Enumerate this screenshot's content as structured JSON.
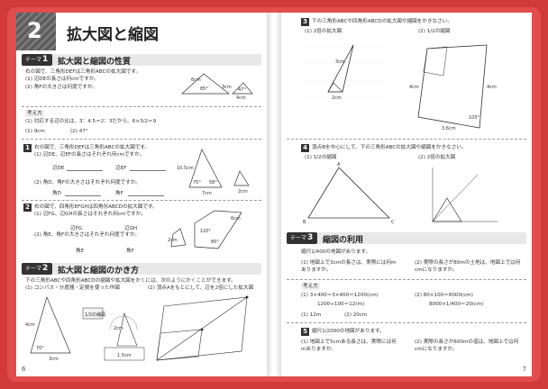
{
  "left": {
    "chapter_number": "2",
    "chapter_title": "拡大図と縮図",
    "page_number": "6",
    "theme1": {
      "tag": "テーマ",
      "num": "1",
      "title": "拡大図と縮図の性質",
      "lines": [
        "右の図で、三角形DEFは三角形ABCの拡大図です。",
        "(1) 辺DEの長さは何cmですか。",
        "(2) 角Fの大きさは何度ですか。"
      ],
      "answer_label": "考え方",
      "answer_line": "(1) 対応する辺の比は、3：4.5＝2：3だから、6×3/2＝9",
      "answers": [
        "(1) 9cm",
        "(2) 47°"
      ],
      "fig_labels": [
        "6cm",
        "85°",
        "3cm",
        "47°",
        "4cm"
      ]
    },
    "q1": {
      "num": "1",
      "lines": [
        "右の図で、三角形DEFは三角形ABCの拡大図です。",
        "(1) 辺DE、辺EFの長さはそれぞれ何cmですか。",
        "(2) 角D、角Fの大きさはそれぞれ何度ですか。"
      ],
      "blanks": [
        "辺DE",
        "辺EF",
        "角D",
        "角F"
      ],
      "fig_labels": [
        "10.5cm",
        "75°",
        "58°",
        "7cm",
        "2cm"
      ]
    },
    "q2": {
      "num": "2",
      "lines": [
        "右の図で、四角形EFGHは四角形ABCDの拡大図です。",
        "(1) 辺FG、辺GHの長さはそれぞれ何cmですか。",
        "(2) 角E、角Fの大きさはそれぞれ何度ですか。"
      ],
      "blanks": [
        "辺FG",
        "辺GH",
        "角E",
        "角F"
      ],
      "fig_labels": [
        "6cm",
        "2cm",
        "120°",
        "80°"
      ]
    },
    "theme2": {
      "tag": "テーマ",
      "num": "2",
      "title": "拡大図と縮図のかき方",
      "lines": [
        "下の三角形ABCや四角形ABCDの縮図や拡大図をかくには、次のようにかくことができます。",
        "(1) コンパス・分度器・定規を使った作図",
        "(2) 頂点Aをもとにして、辺を2倍にした拡大図"
      ],
      "fig_labels": [
        "4cm",
        "70°",
        "1/2の縮図",
        "2cm",
        "3cm",
        "1.5cm"
      ]
    }
  },
  "right": {
    "page_number": "7",
    "q3": {
      "num": "3",
      "line": "下の三角形ABCや四角形ABCDの拡大図や縮図をかきなさい。",
      "sub1": "(1) 2倍の拡大図",
      "sub2": "(2) 1/2の縮図",
      "fig_labels": [
        "3cm",
        "2cm",
        "4cm",
        "4cm",
        "3.6cm",
        "105°"
      ]
    },
    "q4": {
      "num": "4",
      "line": "頂点Bを中心にして、下の三角形ABCの拡大図や縮図をかきなさい。",
      "sub1": "(1) 1/2の縮図",
      "sub2": "(2) 2倍の拡大図",
      "vertex_labels": [
        "A",
        "B",
        "C"
      ]
    },
    "theme3": {
      "tag": "テーマ",
      "num": "3",
      "title": "縮図の利用",
      "lines": [
        "縮尺1/400の地図があります。",
        "(1) 地図上で3cmの長さは、実際には何mありますか。",
        "(2) 実際の長さが80mの土地は、地図上では何cmになりますか。"
      ],
      "answer_label": "考え方",
      "calc": [
        "(1) 3×400＝3×400＝1200(cm)",
        "1200÷100＝12(m)",
        "(2) 80×100＝8000(cm)",
        "8000×1/400＝20(cm)"
      ],
      "answers": [
        "(1) 12m",
        "(2) 20cm"
      ]
    },
    "q5": {
      "num": "5",
      "lines": [
        "縮尺1/2000の地図があります。",
        "(1) 地図上で5cmある長さは、実際には何mありますか。",
        "(2) 実際の長さが600mの道は、地図上では何cmになりますか。"
      ]
    }
  }
}
